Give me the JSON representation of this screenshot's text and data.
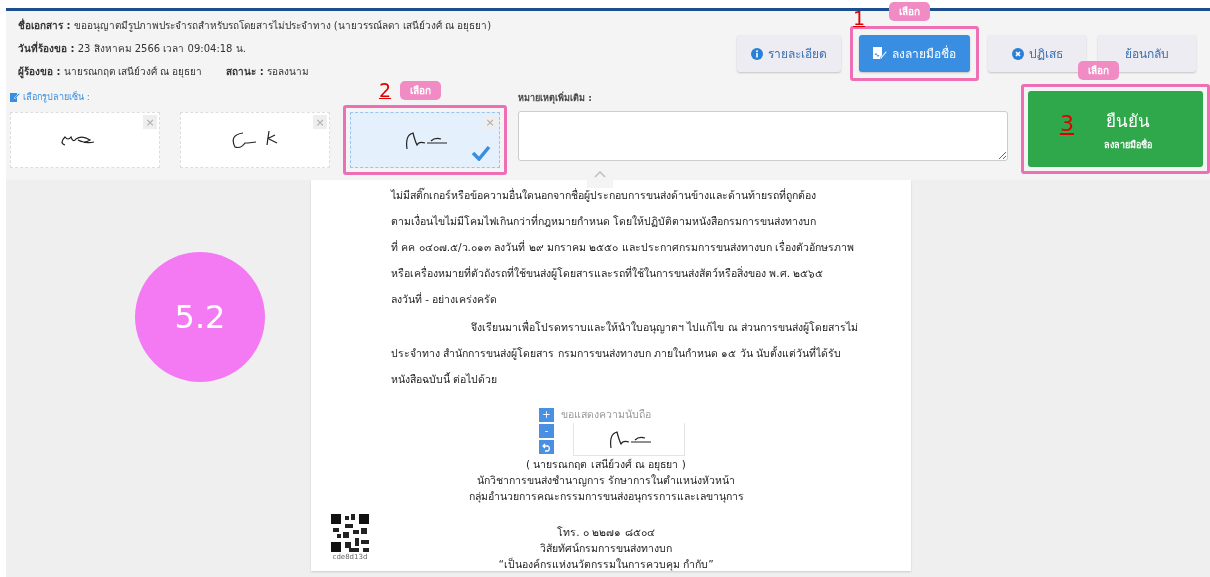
{
  "document_info": [
    [
      {
        "label": "ชื่อเอกสาร :",
        "value": "ขออนุญาตมีรูปภาพประจำรถสำหรับรถโดยสารไม่ประจำทาง (นายวรรณ์ลดา เสนีย์วงศ์ ณ อยุธยา)"
      }
    ],
    [
      {
        "label": "วันที่ร้องขอ :",
        "value": "23 สิงหาคม 2566 เวลา 09:04:18 น."
      }
    ],
    [
      {
        "label": "ผู้ร้องขอ :",
        "value": "นายรณกฤต เสนีย์วงศ์ ณ อยุธยา"
      },
      {
        "label": "สถานะ :",
        "value": "รอลงนาม"
      }
    ]
  ],
  "buttons": [
    {
      "kind": "info",
      "label": "รายละเอียด",
      "selected": false
    },
    {
      "kind": "sign",
      "label": "ลงลายมือชื่อ",
      "selected": true,
      "step": "1",
      "badge": "เลือก"
    },
    {
      "kind": "reject",
      "label": "ปฏิเสธ",
      "selected": false
    },
    {
      "kind": "back",
      "label": "ย้อนกลับ",
      "selected": false
    }
  ],
  "signatures": {
    "label": "เลือกรูปลายเซ็น :",
    "close": "×",
    "items": [
      {
        "selected": false
      },
      {
        "selected": false
      },
      {
        "selected": true,
        "step": "2",
        "badge": "เลือก"
      }
    ]
  },
  "remark": {
    "label": "หมายเหตุเพิ่มเติม :"
  },
  "confirm": {
    "title": "ยืนยัน",
    "subtitle": "ลงลายมือชื่อ",
    "step": "3",
    "badge": "เลือก"
  },
  "callout": "5.2",
  "document": {
    "paragraphs": [
      {
        "indented": false,
        "lines": [
          "ไม่มีสติ๊กเกอร์หรือข้อความอื่นใดนอกจากชื่อผู้ประกอบการขนส่งด้านข้างและด้านท้ายรถที่ถูกต้อง",
          "ตามเงื่อนไขไม่มีโคมไฟเกินกว่าที่กฎหมายกำหนด โดยให้ปฏิบัติตามหนังสือกรมการขนส่งทางบก",
          "ที่ คค ๐๔๐๗.๕/ว.๐๑๓ ลงวันที่ ๒๙ มกราคม ๒๕๕๐ และประกาศกรมการขนส่งทางบก เรื่องตัวอักษรภาพ",
          "หรือเครื่องหมายที่ตัวถังรถที่ใช้ขนส่งผู้โดยสารและรถที่ใช้ในการขนส่งสัตว์หรือสิ่งของ พ.ศ. ๒๕๖๕",
          "ลงวันที่ - อย่างเคร่งครัด"
        ]
      },
      {
        "indented": true,
        "lines": [
          "จึงเรียนมาเพื่อโปรดทราบและให้นำใบอนุญาตฯ ไปแก้ไข ณ ส่วนการขนส่งผู้โดยสารไม่",
          "ประจำทาง สำนักการขนส่งผู้โดยสาร กรมการขนส่งทางบก ภายในกำหนด ๑๕ วัน นับตั้งแต่วันที่ได้รับ",
          "หนังสือฉบับนี้ ต่อไปด้วย"
        ]
      }
    ],
    "closing": "ขอแสดงความนับถือ",
    "zoom_controls": [
      "+",
      "-"
    ],
    "signer": "( นายรณกฤต เสนีย์วงศ์ ณ อยุธยา )",
    "position": [
      "นักวิชาการขนส่งชำนาญการ รักษาการในตำแหน่งหัวหน้า",
      "กลุ่มอำนวยการคณะกรรมการขนส่งอนุกรรการและเลขานุการ"
    ],
    "contact": [
      "โทร. ๐ ๒๒๗๑ ๘๕๐๔",
      "วิสัยทัศน์กรมการขนส่งทางบก",
      "“เป็นองค์กรแห่งนวัตกรรมในการควบคุม กำกับ”"
    ],
    "qr_code": "cde8d13d"
  }
}
